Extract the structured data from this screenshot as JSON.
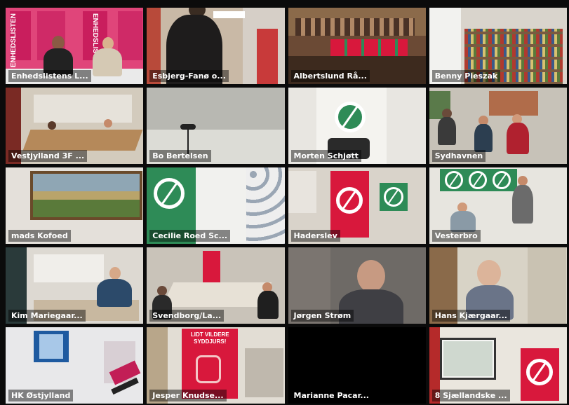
{
  "meeting": {
    "participants": [
      {
        "name": "Enhedslistens L...",
        "active": true
      },
      {
        "name": "Esbjerg-Fanø o..."
      },
      {
        "name": "Albertslund Rå..."
      },
      {
        "name": "Benny Pieszak"
      },
      {
        "name": "Vestjylland 3F ..."
      },
      {
        "name": "Bo Bertelsen"
      },
      {
        "name": "Morten Schjøtt"
      },
      {
        "name": "Sydhavnen"
      },
      {
        "name": "mads Kofoed"
      },
      {
        "name": "Cecilie Roed Sc..."
      },
      {
        "name": "Haderslev"
      },
      {
        "name": "Vesterbro"
      },
      {
        "name": "Kim Mariegaar..."
      },
      {
        "name": "Svendborg/La..."
      },
      {
        "name": "Jørgen Strøm"
      },
      {
        "name": "Hans Kjærgaar..."
      },
      {
        "name": "HK Østjylland"
      },
      {
        "name": "Jesper Knudse..."
      },
      {
        "name": "Marianne Pacar..."
      },
      {
        "name": "8 Sjællandske ..."
      }
    ],
    "banner_text": "ENHEDSLISTEN",
    "poster_text": "LIDT VILDERE SYDDJURS!",
    "colors": {
      "active_border": "#41c93a",
      "party_red": "#d8183c",
      "party_green": "#2e8b57"
    }
  }
}
